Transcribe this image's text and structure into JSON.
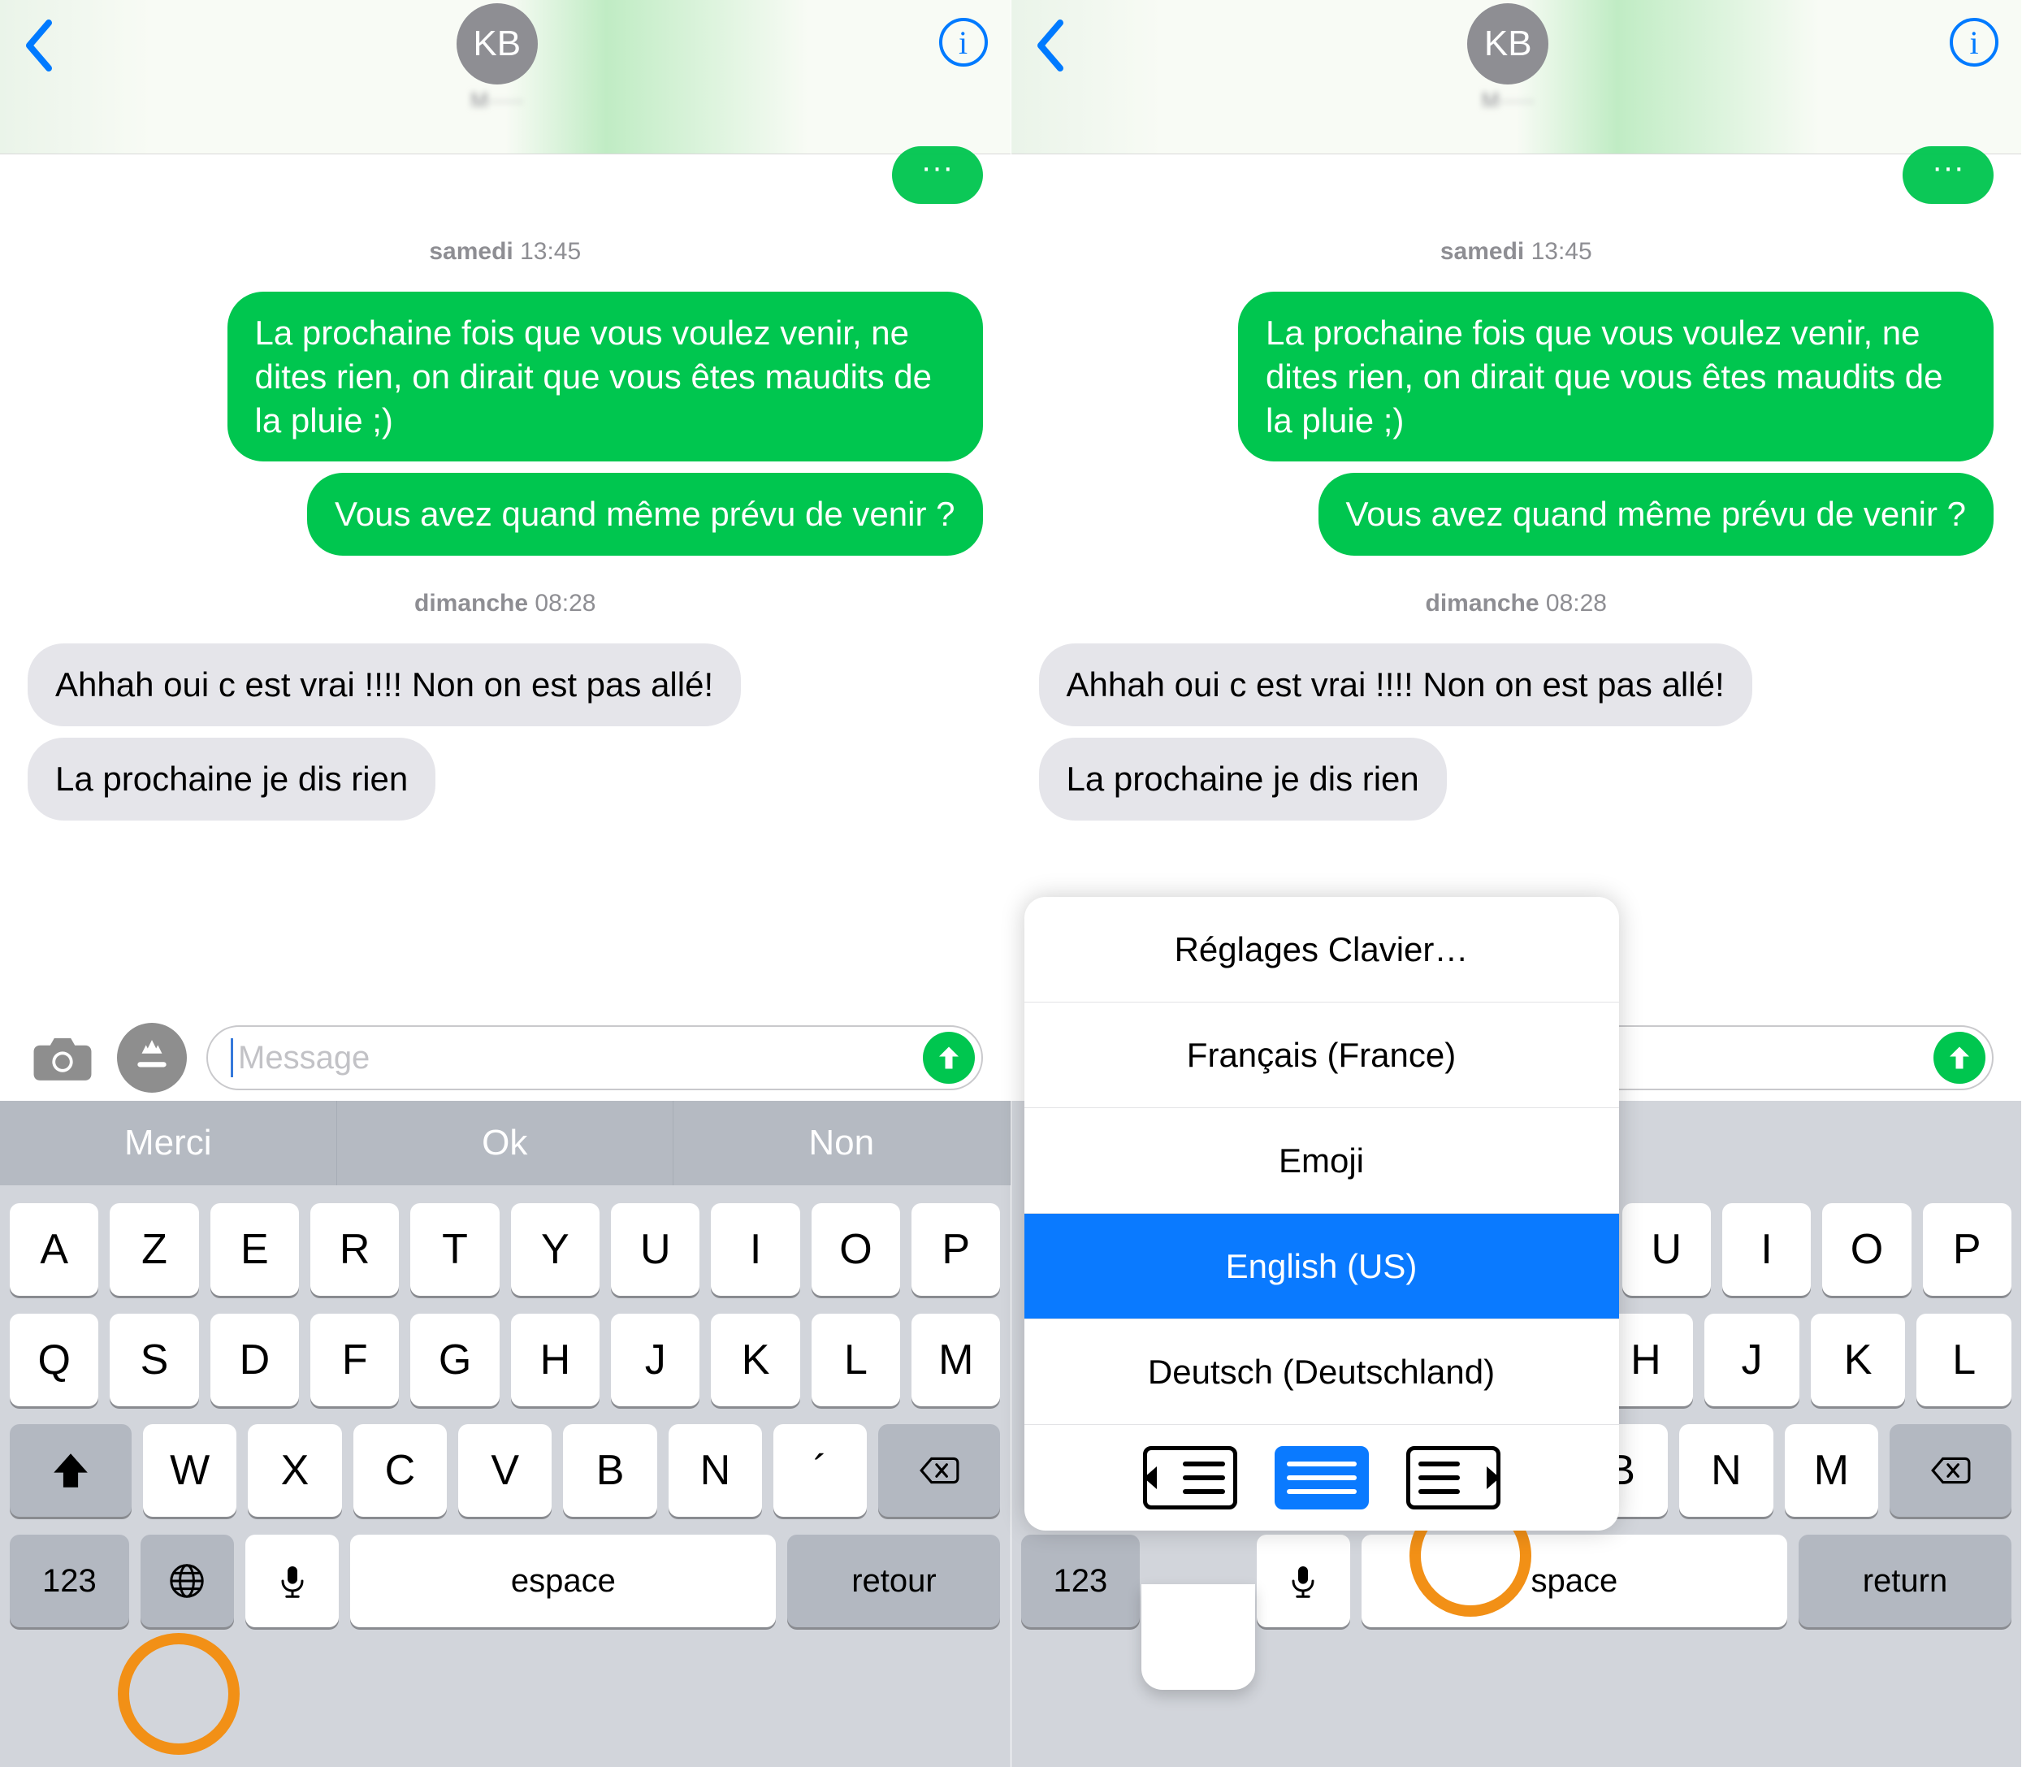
{
  "header": {
    "avatar_initials": "KB",
    "contact_name": "M·····"
  },
  "messages": {
    "cut_text": "···",
    "ts1_day": "samedi",
    "ts1_time": " 13:45",
    "out1": "La prochaine fois que vous voulez venir, ne dites rien, on dirait que vous êtes maudits de la pluie ;)",
    "out2": "Vous avez quand même prévu de venir ?",
    "ts2_day": "dimanche",
    "ts2_time": " 08:28",
    "in1": "Ahhah oui c est vrai !!!! Non on est pas allé!",
    "in2": "La prochaine je dis rien"
  },
  "input": {
    "placeholder": "Message"
  },
  "kb_left": {
    "suggestions": [
      "Merci",
      "Ok",
      "Non"
    ],
    "row1": [
      "A",
      "Z",
      "E",
      "R",
      "T",
      "Y",
      "U",
      "I",
      "O",
      "P"
    ],
    "row2": [
      "Q",
      "S",
      "D",
      "F",
      "G",
      "H",
      "J",
      "K",
      "L",
      "M"
    ],
    "row3": [
      "W",
      "X",
      "C",
      "V",
      "B",
      "N",
      "´"
    ],
    "numbers": "123",
    "space": "espace",
    "return": "retour"
  },
  "kb_right": {
    "row1_tail": [
      "U",
      "I",
      "O",
      "P"
    ],
    "row2_tail": [
      "H",
      "J",
      "K",
      "L"
    ],
    "row3_tail": [
      "B",
      "N",
      "M"
    ],
    "numbers": "123",
    "space": "space",
    "return": "return"
  },
  "popup": {
    "settings": "Réglages Clavier…",
    "opt1": "Français (France)",
    "opt2": "Emoji",
    "opt3": "English (US)",
    "opt4": "Deutsch (Deutschland)"
  }
}
